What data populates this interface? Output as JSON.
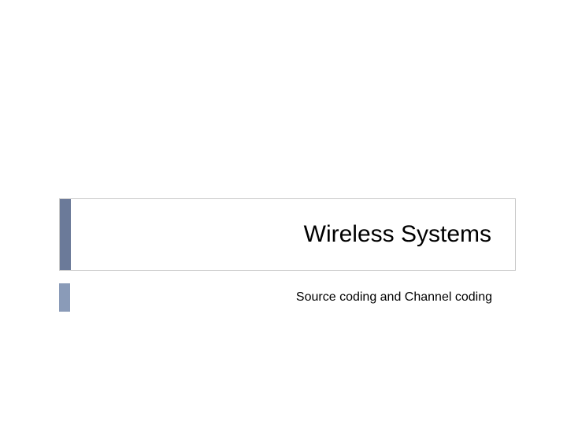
{
  "slide": {
    "title": "Wireless Systems",
    "subtitle": "Source coding and Channel coding"
  },
  "colors": {
    "title_accent": "#6b7a99",
    "subtitle_accent": "#8a9bb8",
    "border": "#c8c8c8"
  }
}
